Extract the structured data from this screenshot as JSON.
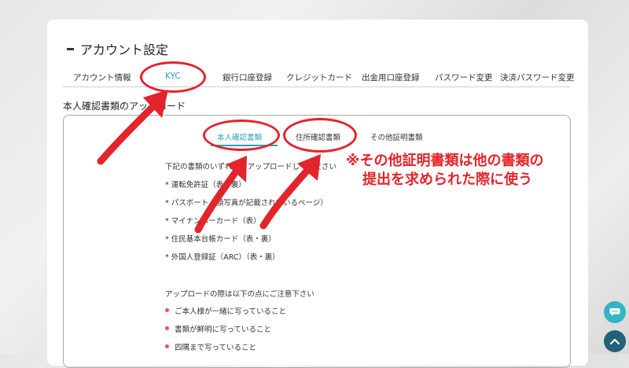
{
  "header": {
    "title": "アカウント設定"
  },
  "tabs": [
    {
      "label": "アカウント情報"
    },
    {
      "label": "KYC"
    },
    {
      "label": "銀行口座登録"
    },
    {
      "label": "クレジットカード"
    },
    {
      "label": "出金用口座登録"
    },
    {
      "label": "パスワード変更"
    },
    {
      "label": "決済パスワード変更"
    }
  ],
  "active_tab": "KYC",
  "section": {
    "title": "本人確認書類のアップロード"
  },
  "subtabs": [
    {
      "label": "本人確認書類"
    },
    {
      "label": "住所確認書類"
    },
    {
      "label": "その他証明書類"
    }
  ],
  "content": {
    "intro": "下記の書類のいずれかをアップロードしてください",
    "documents": [
      "* 運転免許証（表・裏）",
      "* パスポート（顔写真が記載されているページ）",
      "* マイナンバーカード（表）",
      "* 住民基本台帳カード（表・裏）",
      "* 外国人登録証（ARC）（表・裏）"
    ],
    "notes_title": "アップロードの際は以下の点にご注意下さい",
    "notes": [
      "ご本人様が一緒に写っていること",
      "書類が鮮明に写っていること",
      "四隅まで写っていること"
    ]
  },
  "annotation": {
    "line1": "※その他証明書類は他の書類の",
    "line2": "提出を求められた際に使う"
  },
  "colors": {
    "accent": "#2aa3b5",
    "annotation_red": "#e3242b",
    "bullet_pink": "#e2507a",
    "chat_button": "#34b4c4",
    "top_button": "#23607a"
  },
  "icons": {
    "chat": "chat-bubble-icon",
    "scroll_top": "chevron-up-icon"
  }
}
